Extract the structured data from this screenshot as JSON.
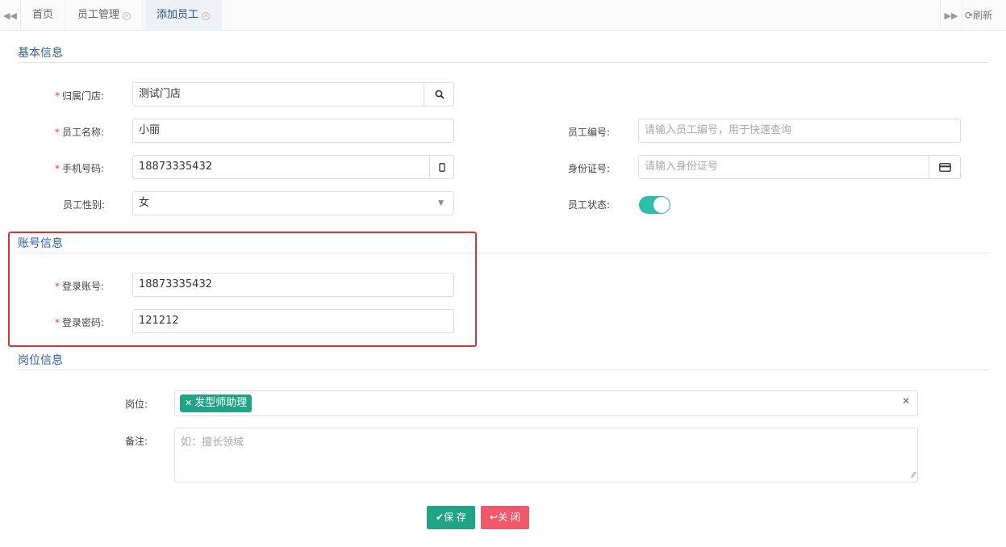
{
  "tabs": [
    {
      "label": "首页"
    },
    {
      "label": "员工管理"
    },
    {
      "label": "添加员工"
    }
  ],
  "tabbar": {
    "refresh_label": "刷新"
  },
  "sections": {
    "basic": "基本信息",
    "account": "账号信息",
    "position": "岗位信息"
  },
  "basic": {
    "store_label": "归属门店:",
    "store_value": "测试门店",
    "name_label": "员工名称:",
    "name_value": "小丽",
    "emp_no_label": "员工编号:",
    "emp_no_placeholder": "请输入员工编号，用于快速查询",
    "phone_label": "手机号码:",
    "phone_value": "18873335432",
    "id_label": "身份证号:",
    "id_placeholder": "请输入身份证号",
    "gender_label": "员工性别:",
    "gender_value": "女",
    "status_label": "员工状态:",
    "status_on": true
  },
  "account": {
    "login_label": "登录账号:",
    "login_value": "18873335432",
    "password_label": "登录密码:",
    "password_value": "121212"
  },
  "position": {
    "post_label": "岗位:",
    "post_tag": "发型师助理",
    "remark_label": "备注:",
    "remark_placeholder": "如：擅长领域"
  },
  "buttons": {
    "save": "保 存",
    "close": "关 闭"
  },
  "colors": {
    "accent": "#1fa585",
    "danger": "#ef5a6a",
    "highlight": "#e03030",
    "section_title": "#2a5ca8",
    "required": "#e5393a"
  }
}
